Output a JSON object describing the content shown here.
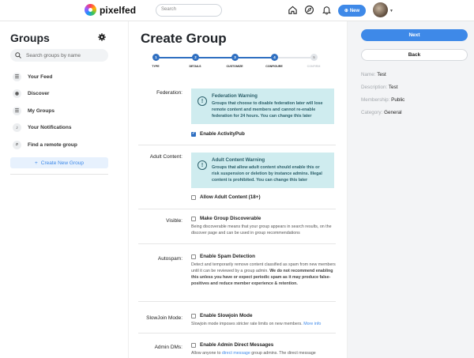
{
  "topbar": {
    "brand": "pixelfed",
    "search_placeholder": "Search",
    "new_label": "New",
    "icons": [
      "home-icon",
      "compass-icon",
      "bell-icon"
    ]
  },
  "sidebar": {
    "title": "Groups",
    "search_placeholder": "Search groups by name",
    "items": [
      {
        "label": "Your Feed",
        "icon": "list-icon"
      },
      {
        "label": "Discover",
        "icon": "compass-icon"
      },
      {
        "label": "My Groups",
        "icon": "list-icon"
      },
      {
        "label": "Your Notifications",
        "icon": "bell-icon"
      },
      {
        "label": "Find a remote group",
        "icon": "search-icon"
      }
    ],
    "create_label": "Create New Group"
  },
  "main": {
    "title": "Create Group",
    "steps": [
      {
        "num": "1",
        "label": "TYPE",
        "done": true
      },
      {
        "num": "2",
        "label": "DETAILS",
        "done": true
      },
      {
        "num": "3",
        "label": "CUSTOMIZE",
        "done": true
      },
      {
        "num": "4",
        "label": "CONFIGURE",
        "done": true
      },
      {
        "num": "5",
        "label": "CONFIRM",
        "done": false
      }
    ],
    "federation": {
      "label": "Federation:",
      "warning_title": "Federation Warning",
      "warning_text": "Groups that choose to disable federation later will lose remote content and members and cannot re-enable federation for 24 hours. You can change this later",
      "checkbox_label": "Enable ActivityPub",
      "checked": true
    },
    "adult": {
      "label": "Adult Content:",
      "warning_title": "Adult Content Warning",
      "warning_text": "Groups that allow adult content should enable this or risk suspension or deletion by instance admins. Illegal content is prohibited. You can change this later",
      "checkbox_label": "Allow Adult Content (18+)",
      "checked": false
    },
    "visible": {
      "label": "Visible:",
      "checkbox_label": "Make Group Discoverable",
      "desc": "Being discoverable means that your group appears in search results, on the discover page and can be used in group recommendations",
      "checked": false
    },
    "autospam": {
      "label": "Autospam:",
      "checkbox_label": "Enable Spam Detection",
      "desc": "Detect and temporarily remove content classified as spam from new members until it can be reviewed by a group admin.",
      "desc_bold": "We do not recommend enabling this unless you have or expect periodic spam as it may produce false-positives and reduce member experience & retention.",
      "checked": false
    },
    "slowjoin": {
      "label": "SlowJoin Mode:",
      "checkbox_label": "Enable Slowjoin Mode",
      "desc": "Slowjoin mode imposes stricter rate limits on new members.",
      "link": "More info",
      "checked": false
    },
    "admindms": {
      "label": "Admin DMs:",
      "checkbox_label": "Enable Admin Direct Messages",
      "desc_pre": "Allow anyone to",
      "link": "direct message",
      "desc_post": "group admins. The direct message",
      "checked": false
    }
  },
  "right": {
    "next_label": "Next",
    "back_label": "Back",
    "summary": [
      {
        "key": "Name:",
        "value": "Test"
      },
      {
        "key": "Description:",
        "value": "Test"
      },
      {
        "key": "Membership:",
        "value": "Public"
      },
      {
        "key": "Category:",
        "value": "General"
      }
    ]
  },
  "colors": {
    "accent": "#3e89e8",
    "step": "#2f6fc1",
    "warning_bg": "#cfecef",
    "warning_text": "#2b5f6a"
  }
}
